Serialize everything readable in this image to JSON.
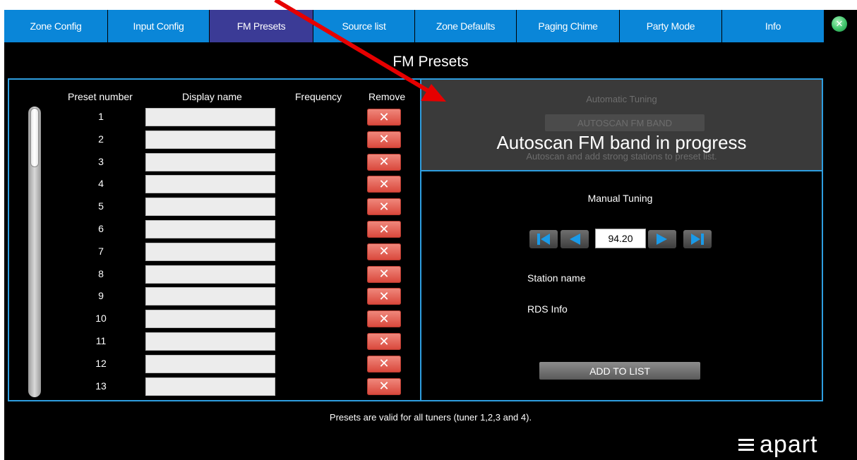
{
  "tabs": [
    {
      "label": "Zone Config"
    },
    {
      "label": "Input Config"
    },
    {
      "label": "FM Presets"
    },
    {
      "label": "Source list"
    },
    {
      "label": "Zone Defaults"
    },
    {
      "label": "Paging Chime"
    },
    {
      "label": "Party Mode"
    },
    {
      "label": "Info"
    }
  ],
  "active_tab": "FM Presets",
  "page_title": "FM Presets",
  "table": {
    "headers": {
      "preset_number": "Preset number",
      "display_name": "Display name",
      "frequency": "Frequency",
      "remove": "Remove"
    },
    "rows": [
      {
        "number": "1",
        "name": "",
        "frequency": ""
      },
      {
        "number": "2",
        "name": "",
        "frequency": ""
      },
      {
        "number": "3",
        "name": "",
        "frequency": ""
      },
      {
        "number": "4",
        "name": "",
        "frequency": ""
      },
      {
        "number": "5",
        "name": "",
        "frequency": ""
      },
      {
        "number": "6",
        "name": "",
        "frequency": ""
      },
      {
        "number": "7",
        "name": "",
        "frequency": ""
      },
      {
        "number": "8",
        "name": "",
        "frequency": ""
      },
      {
        "number": "9",
        "name": "",
        "frequency": ""
      },
      {
        "number": "10",
        "name": "",
        "frequency": ""
      },
      {
        "number": "11",
        "name": "",
        "frequency": ""
      },
      {
        "number": "12",
        "name": "",
        "frequency": ""
      },
      {
        "number": "13",
        "name": "",
        "frequency": ""
      }
    ],
    "remove_glyph": "✕"
  },
  "auto_tuning": {
    "title": "Automatic Tuning",
    "button_label": "AUTOSCAN FM BAND",
    "description": "Autoscan and add strong stations to preset list.",
    "progress_message": "Autoscan FM band in progress"
  },
  "manual_tuning": {
    "title": "Manual Tuning",
    "frequency_value": "94.20",
    "station_name_label": "Station name",
    "rds_info_label": "RDS Info",
    "add_button_label": "ADD TO LIST"
  },
  "footer_note": "Presets are valid for all tuners (tuner 1,2,3 and 4).",
  "logo": {
    "text": "apart"
  },
  "colors": {
    "tab": "#0a86d8",
    "tab_active": "#3b3b96",
    "panel_border": "#2e9ee0",
    "remove_button": "#e0544a",
    "arrow": "#e60000"
  },
  "icons": {
    "close_status": "close-circle-icon",
    "skip_back": "skip-back-icon",
    "step_back": "step-back-icon",
    "step_forward": "step-forward-icon",
    "skip_forward": "skip-forward-icon",
    "remove": "x-icon"
  }
}
